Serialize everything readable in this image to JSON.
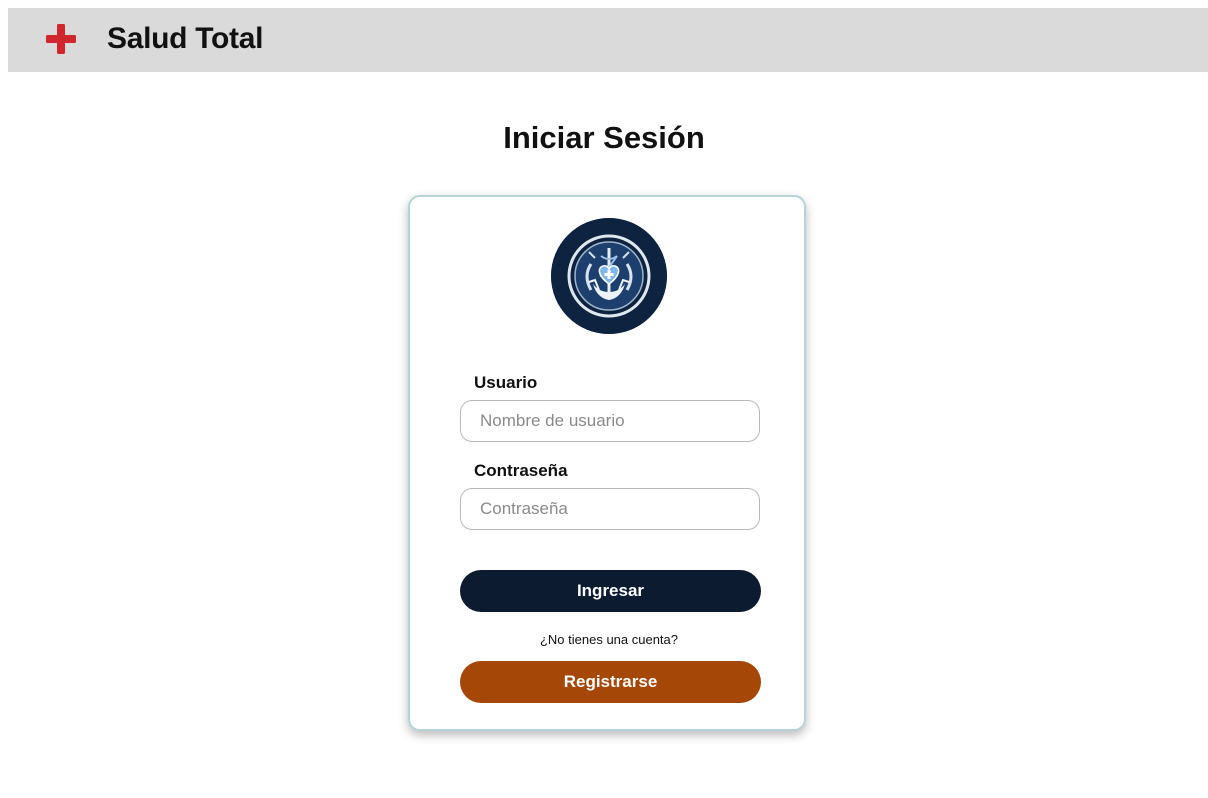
{
  "header": {
    "brand_name": "Salud Total",
    "brand_icon": "red-cross-icon",
    "brand_color": "#d0262d",
    "background": "#dadada"
  },
  "page": {
    "title": "Iniciar Sesión"
  },
  "login_card": {
    "logo_icon": "caduceus-heart-hands-emblem",
    "username": {
      "label": "Usuario",
      "placeholder": "Nombre de usuario",
      "value": ""
    },
    "password": {
      "label": "Contraseña",
      "placeholder": "Contraseña",
      "value": ""
    },
    "login_button": "Ingresar",
    "signup_prompt": "¿No tienes una cuenta?",
    "signup_button": "Registrarse",
    "colors": {
      "login_button": "#0c1b30",
      "signup_button": "#a44707",
      "card_border": "#b5d3d8"
    }
  }
}
